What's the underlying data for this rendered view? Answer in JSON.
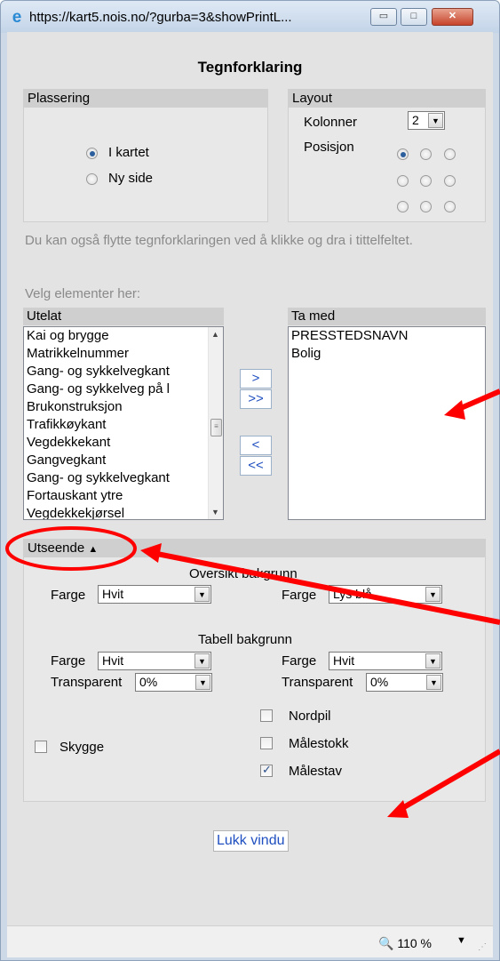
{
  "window": {
    "url": "https://kart5.nois.no/?gurba=3&showPrintL...",
    "minimize": "▭",
    "maximize": "□",
    "close": "✕"
  },
  "dialog": {
    "heading": "Tegnforklaring"
  },
  "placement": {
    "header": "Plassering",
    "options": [
      "I kartet",
      "Ny side"
    ],
    "selected": "I kartet"
  },
  "layout": {
    "header": "Layout",
    "columns_label": "Kolonner",
    "columns_value": "2",
    "position_label": "Posisjon"
  },
  "help_text": "Du kan også flytte tegnforklaringen ved å klikke og dra i tittelfeltet.",
  "select_prompt": "Velg elementer her:",
  "excluded": {
    "header": "Utelat",
    "items": [
      "Kai og brygge",
      "Matrikkelnummer",
      "Gang- og sykkelvegkant",
      "Gang- og sykkelveg på l",
      "Brukonstruksjon",
      "Trafikkøykant",
      "Vegdekkekant",
      "Gangvegkant",
      "Gang- og sykkelvegkant",
      "Fortauskant ytre",
      "Vegdekkekjørsel"
    ]
  },
  "included": {
    "header": "Ta med",
    "items": [
      "PRESSTEDSNAVN",
      "Bolig"
    ]
  },
  "move_buttons": {
    "add": ">",
    "add_all": ">>",
    "remove": "<",
    "remove_all": "<<"
  },
  "appearance": {
    "header": "Utseende",
    "toggle_glyph": "▲",
    "overview_title": "Oversikt bakgrunn",
    "table_title": "Tabell bakgrunn",
    "color_label": "Farge",
    "transparent_label": "Transparent",
    "overview_left_color": "Hvit",
    "overview_right_color": "Lys blå",
    "table_left_color": "Hvit",
    "table_right_color": "Hvit",
    "table_left_transparent": "0%",
    "table_right_transparent": "0%",
    "shadow_label": "Skygge",
    "north_arrow_label": "Nordpil",
    "scale_label": "Målestokk",
    "scale_bar_label": "Målestav"
  },
  "checkboxes": {
    "skygge": false,
    "nordpil": false,
    "malestokk": false,
    "malestav": true
  },
  "close_link": "Lukk vindu",
  "statusbar": {
    "zoom": "110 %",
    "zoom_icon": "🔍"
  },
  "colors": {
    "annotation": "#ff0000",
    "link": "#1f4fc0",
    "panel_header": "#cfcfcf"
  }
}
